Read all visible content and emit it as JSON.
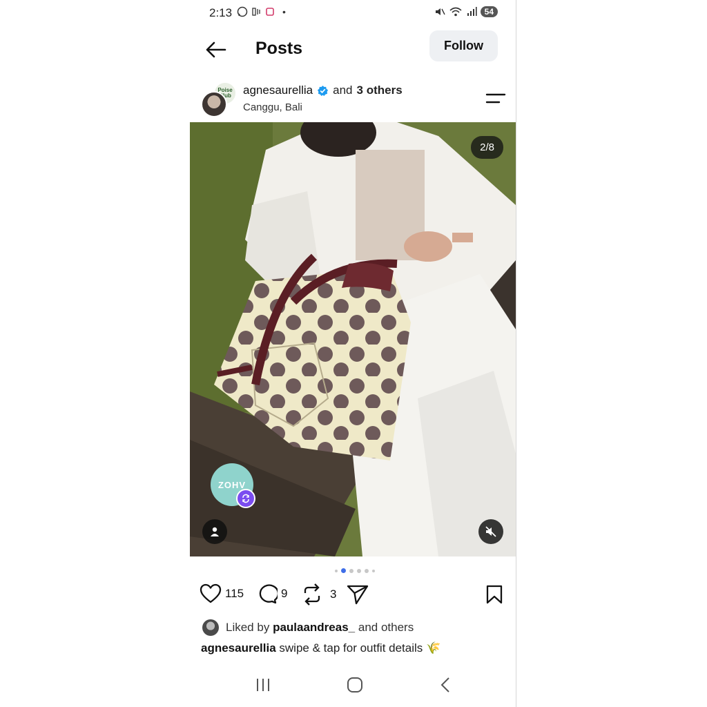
{
  "status_bar": {
    "time": "2:13",
    "dot": "•",
    "battery": "54"
  },
  "header": {
    "title": "Posts",
    "follow_label": "Follow"
  },
  "post": {
    "username": "agnesaurellia",
    "coauthors_prefix": "and",
    "coauthors_count": "3 others",
    "location": "Canggu, Bali",
    "avatar_back_text": "Poise Club",
    "image_counter": "2/8",
    "brand_badge_text": "ZOHV",
    "likes": "115",
    "comments": "9",
    "reposts": "3",
    "liked_by_prefix": "Liked by",
    "liked_by_user": "paulaandreas_",
    "liked_by_suffix": "and others",
    "caption_user": "agnesaurellia",
    "caption_text": "swipe & tap for outfit details 🌾"
  },
  "colors": {
    "accent_blue": "#3f6ee8",
    "verified_blue": "#1d9bf0",
    "badge_teal": "#8fd3cc",
    "sync_purple": "#7b4df0"
  },
  "icons": [
    "back-arrow-icon",
    "verified-icon",
    "menu-icon",
    "heart-icon",
    "comment-icon",
    "repost-icon",
    "share-icon",
    "bookmark-icon",
    "person-tag-icon",
    "mute-icon",
    "recents-icon",
    "home-icon",
    "back-icon"
  ]
}
